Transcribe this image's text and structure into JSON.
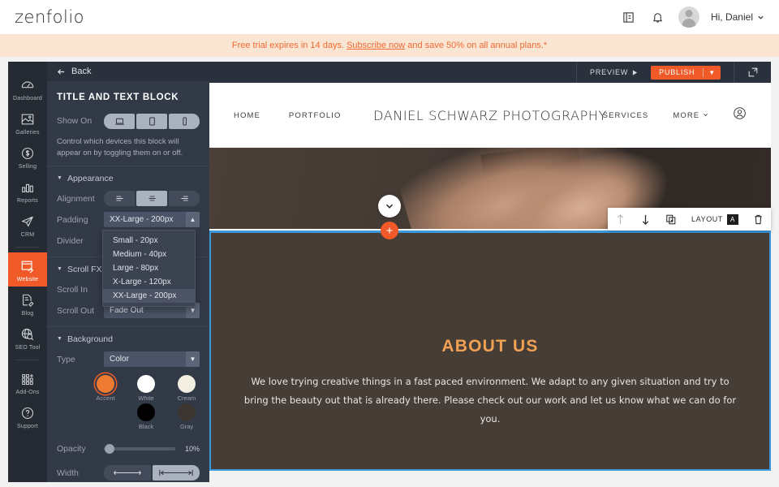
{
  "header": {
    "logo": "zenfolio",
    "greeting": "Hi, Daniel",
    "icons": {
      "guide": "book-icon",
      "bell": "bell-icon",
      "avatar": "avatar"
    }
  },
  "banner": {
    "prefix": "Free trial expires in 14 days.",
    "link": "Subscribe now",
    "suffix": "and save 50% on all annual plans.*"
  },
  "sidebar": {
    "items": [
      {
        "label": "Dashboard",
        "icon": "gauge-icon",
        "active": false
      },
      {
        "label": "Galleries",
        "icon": "photo-icon",
        "active": false
      },
      {
        "label": "Selling",
        "icon": "dollar-coin-icon",
        "active": false
      },
      {
        "label": "Reports",
        "icon": "bar-chart-icon",
        "active": false
      },
      {
        "label": "CRM",
        "icon": "paper-plane-icon",
        "active": false
      },
      {
        "label": "Website",
        "icon": "website-edit-icon",
        "active": true
      },
      {
        "label": "Blog",
        "icon": "document-edit-icon",
        "active": false
      },
      {
        "label": "SEO Tool",
        "icon": "globe-search-icon",
        "active": false
      },
      {
        "label": "Add-Ons",
        "icon": "grid-plus-icon",
        "active": false
      },
      {
        "label": "Support",
        "icon": "question-circle-icon",
        "active": false
      }
    ]
  },
  "panel": {
    "back_label": "Back",
    "title": "TITLE AND TEXT BLOCK",
    "show_on": {
      "label": "Show On",
      "devices": [
        "laptop-icon",
        "tablet-icon",
        "phone-icon"
      ],
      "help": "Control which devices this block will appear on by toggling them on or off."
    },
    "appearance": {
      "section_label": "Appearance",
      "alignment_label": "Alignment",
      "alignment_options": [
        "align-left-icon",
        "align-center-icon",
        "align-right-icon"
      ],
      "alignment_selected": 1,
      "padding_label": "Padding",
      "padding_value": "XX-Large - 200px",
      "padding_options": [
        "Small - 20px",
        "Medium - 40px",
        "Large - 80px",
        "X-Large - 120px",
        "XX-Large - 200px"
      ],
      "padding_selected": 4,
      "divider_label": "Divider"
    },
    "scroll_fx": {
      "section_label": "Scroll FX",
      "scroll_in_label": "Scroll In",
      "scroll_out_label": "Scroll Out",
      "scroll_out_value": "Fade Out"
    },
    "background": {
      "section_label": "Background",
      "type_label": "Type",
      "type_value": "Color",
      "swatches": [
        {
          "name": "Accent",
          "color": "#ef7b33",
          "selected": true
        },
        {
          "name": "White",
          "color": "#ffffff",
          "selected": false
        },
        {
          "name": "Cream",
          "color": "#f2eee1",
          "selected": false
        },
        {
          "name": "Black",
          "color": "#000000",
          "selected": false
        },
        {
          "name": "Gray",
          "color": "#3b3631",
          "selected": false
        }
      ],
      "opacity_label": "Opacity",
      "opacity_value": "10%",
      "width_label": "Width",
      "width_options": [
        "contained-width-icon",
        "full-width-icon"
      ],
      "width_selected": 1
    }
  },
  "editor_toolbar": {
    "preview_label": "PREVIEW",
    "publish_label": "PUBLISH",
    "expand_icon": "expand-icon"
  },
  "block_toolbar": {
    "move_up": "arrow-up-icon",
    "move_down": "arrow-down-icon",
    "duplicate": "duplicate-icon",
    "layout_label": "LAYOUT",
    "layout_badge": "A",
    "delete": "trash-icon"
  },
  "site": {
    "title": "DANIEL SCHWARZ PHOTOGRAPHY",
    "nav_left": [
      "HOME",
      "PORTFOLIO"
    ],
    "nav_right": [
      "SERVICES",
      "MORE"
    ],
    "account_icon": "user-circle-icon",
    "scroll_down_icon": "chevron-down-circle-icon",
    "add_block_icon": "plus-circle-icon"
  },
  "about": {
    "heading": "ABOUT US",
    "body": "We love trying creative things in a fast paced environment. We adapt to any given situation and try to bring the beauty out that is already there. Please check out our work and let us know what we can do for you."
  },
  "colors": {
    "accent": "#f05a28",
    "banner_bg": "#fae4d2",
    "panel_bg": "#333a47",
    "selection_border": "#3d97d9",
    "about_bg": "#463d37",
    "about_heading": "#f2a153"
  }
}
